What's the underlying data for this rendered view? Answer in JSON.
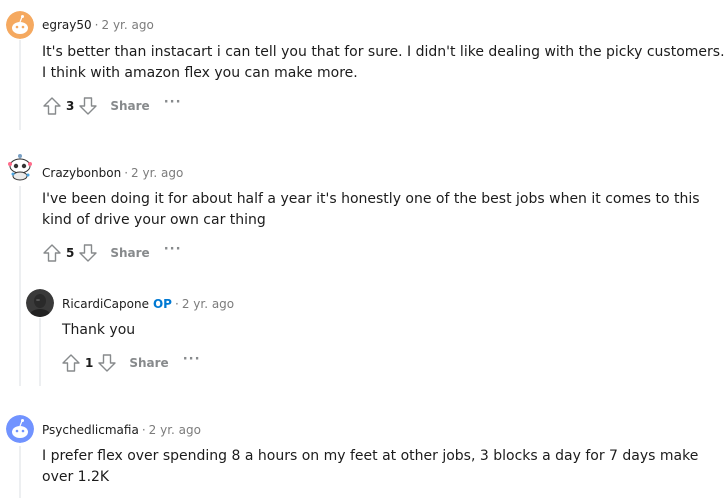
{
  "comments": [
    {
      "username": "egray50",
      "op": "",
      "separator": "·",
      "time": "2 yr. ago",
      "body_line1": "It's better than instacart i can tell you that for sure. I didn't like dealing with the picky customers.",
      "body_line2": "I think with amazon flex you can make more.",
      "score": "3",
      "share_label": "Share",
      "more_label": "···"
    },
    {
      "username": "Crazybonbon",
      "op": "",
      "separator": "·",
      "time": "2 yr. ago",
      "body_line1": "I've been doing it for about half a year it's honestly one of the best jobs when it comes to this",
      "body_line2": "kind of drive your own car thing",
      "score": "5",
      "share_label": "Share",
      "more_label": "···"
    },
    {
      "username": "RicardiCapone",
      "op": "OP",
      "separator": "·",
      "time": "2 yr. ago",
      "body_line1": "Thank you",
      "body_line2": "",
      "score": "1",
      "share_label": "Share",
      "more_label": "···"
    },
    {
      "username": "Psychedlicmafia",
      "op": "",
      "separator": "·",
      "time": "2 yr. ago",
      "body_line1": "I prefer flex over spending 8 a hours on my feet at other jobs, 3 blocks a day for 7 days make",
      "body_line2": "over 1.2K",
      "score": "",
      "share_label": "",
      "more_label": ""
    }
  ],
  "colors": {
    "op_badge": "#0079d3",
    "meta_gray": "#7c7c7c",
    "action_gray": "#878a8c",
    "thread_line": "#edeff1"
  }
}
